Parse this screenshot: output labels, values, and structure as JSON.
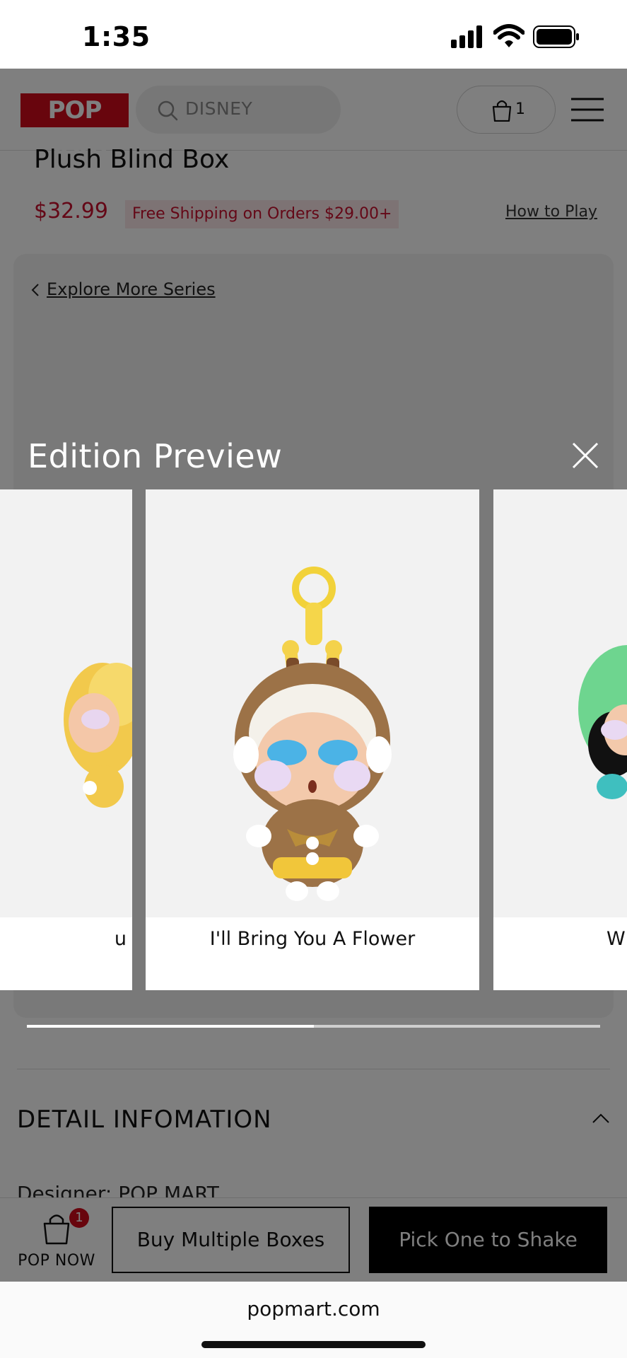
{
  "status_bar": {
    "time": "1:35"
  },
  "header": {
    "logo": "POP MART",
    "search_placeholder": "DISNEY",
    "cart_count": "1"
  },
  "product": {
    "title": "Plush Blind Box",
    "price": "$32.99",
    "shipping": "Free Shipping on Orders $29.00+",
    "how_to_play": "How to Play"
  },
  "series": {
    "explore_link": "Explore More Series"
  },
  "modal": {
    "title": "Edition Preview",
    "cards": [
      {
        "label": "u"
      },
      {
        "label": "I'll Bring You A Flower"
      },
      {
        "label": "Wh"
      }
    ],
    "progress": 0.5
  },
  "details": {
    "heading": "DETAIL INFOMATION",
    "designer": "Designer: POP MART"
  },
  "bottom_bar": {
    "pop_now_label": "POP NOW",
    "badge_count": "1",
    "buy_multiple": "Buy Multiple Boxes",
    "pick_one": "Pick One to Shake"
  },
  "browser": {
    "url": "popmart.com"
  },
  "colors": {
    "brand_red": "#d00a1b",
    "price_red": "#c8102e",
    "overlay": "rgba(0,0,0,0.5)"
  }
}
